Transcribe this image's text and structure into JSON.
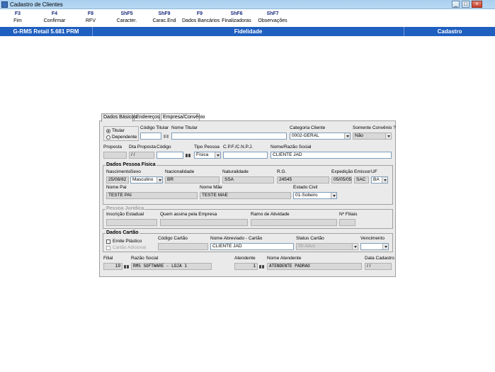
{
  "window": {
    "title": "Cadastro de Clientes"
  },
  "toolbar": [
    {
      "key": "F3",
      "label": "Fim"
    },
    {
      "key": "F4",
      "label": "Confirmar"
    },
    {
      "key": "F8",
      "label": "RFV"
    },
    {
      "key": "ShF5",
      "label": "Caracter."
    },
    {
      "key": "ShF9",
      "label": "Carac.End"
    },
    {
      "key": "F9",
      "label": "Dados Bancários"
    },
    {
      "key": "ShF6",
      "label": "Finalizadoras"
    },
    {
      "key": "ShF7",
      "label": "Observações"
    }
  ],
  "statusbar": {
    "product": "G-RMS Retail 5.681 PRM",
    "module": "Fidelidade",
    "screen": "Cadastro"
  },
  "tabs": [
    {
      "label": "Dados Básicos",
      "active": true
    },
    {
      "label": "Endereços",
      "active": false
    },
    {
      "label": "Empresa/Convênio",
      "active": false
    }
  ],
  "form": {
    "tipo": {
      "titular": "Titular",
      "dependente": "Dependente",
      "selected": "Titular"
    },
    "codigo_titular": {
      "label": "Código Titular",
      "value": ""
    },
    "nome_titular": {
      "label": "Nome Titular",
      "value": ""
    },
    "categoria_cliente": {
      "label": "Categoria Cliente",
      "value": "0002-GERAL"
    },
    "somente_convenio": {
      "label": "Somente Convênio ?",
      "value": "Não"
    },
    "proposta": {
      "label": "Proposta",
      "value": ""
    },
    "dta_proposta": {
      "label": "Dta Proposta",
      "value": "/ /"
    },
    "codigo": {
      "label": "Código",
      "value": ""
    },
    "tipo_pessoa": {
      "label": "Tipo Pessoa",
      "value": "Física"
    },
    "cpf_cnpj": {
      "label": "C.P.F./C.N.P.J.",
      "value": ""
    },
    "nome_razao": {
      "label": "Nome/Razão Social",
      "value": "CLIENTE JAD"
    },
    "pessoa_fisica": {
      "title": "Dados Pessoa Física",
      "nascimento": {
        "label": "Nascimento",
        "value": "25/08/82"
      },
      "sexo": {
        "label": "Sexo",
        "value": "Masculino"
      },
      "nacionalidade": {
        "label": "Nacionalidade",
        "value": "BR"
      },
      "naturalidade": {
        "label": "Naturalidade",
        "value": "SSA"
      },
      "rg": {
        "label": "R.G.",
        "value": "24545"
      },
      "expedicao": {
        "label": "Expedição",
        "value": "05/05/05"
      },
      "emissor": {
        "label": "Emissor",
        "value": "SAC"
      },
      "uf": {
        "label": "UF",
        "value": "BA"
      },
      "nome_pai": {
        "label": "Nome Pai",
        "value": "TESTE PAI"
      },
      "nome_mae": {
        "label": "Nome Mãe",
        "value": "TESTE MAE"
      },
      "estado_civil": {
        "label": "Estado Civil",
        "value": "01-Solteiro"
      }
    },
    "pessoa_juridica": {
      "title": "Pessoa Jurídica",
      "inscricao_estadual": {
        "label": "Inscrição Estadual",
        "value": ""
      },
      "quem_assina": {
        "label": "Quem assina pela Empresa",
        "value": ""
      },
      "ramo_atividade": {
        "label": "Ramo de Atividade",
        "value": ""
      },
      "num_filiais": {
        "label": "Nº Filiais",
        "value": ""
      }
    },
    "cartao": {
      "title": "Dados Cartão",
      "emite_plastico": {
        "label": "Emite Plástico",
        "checked": false
      },
      "cartao_adicional": {
        "label": "Cartão Adicional",
        "checked": false
      },
      "codigo_cartao": {
        "label": "Código Cartão",
        "value": ""
      },
      "nome_abreviado": {
        "label": "Nome Abreviado - Cartão",
        "value": "CLIENTE JAD"
      },
      "status_cartao": {
        "label": "Status Cartão",
        "value": "00-Ativo"
      },
      "vencimento": {
        "label": "Vencimento",
        "value": ""
      }
    },
    "filial": {
      "label": "Filial",
      "value": "19"
    },
    "razao_social": {
      "label": "Razão Social",
      "value": "RMS SOFTWARE - LOJA 1"
    },
    "atendente": {
      "label": "Atendente",
      "value": "1"
    },
    "nome_atendente": {
      "label": "Nome Atendente",
      "value": "ATENDENTE PADRAO"
    },
    "data_cadastro": {
      "label": "Data Cadastro",
      "value": "/ /"
    }
  }
}
